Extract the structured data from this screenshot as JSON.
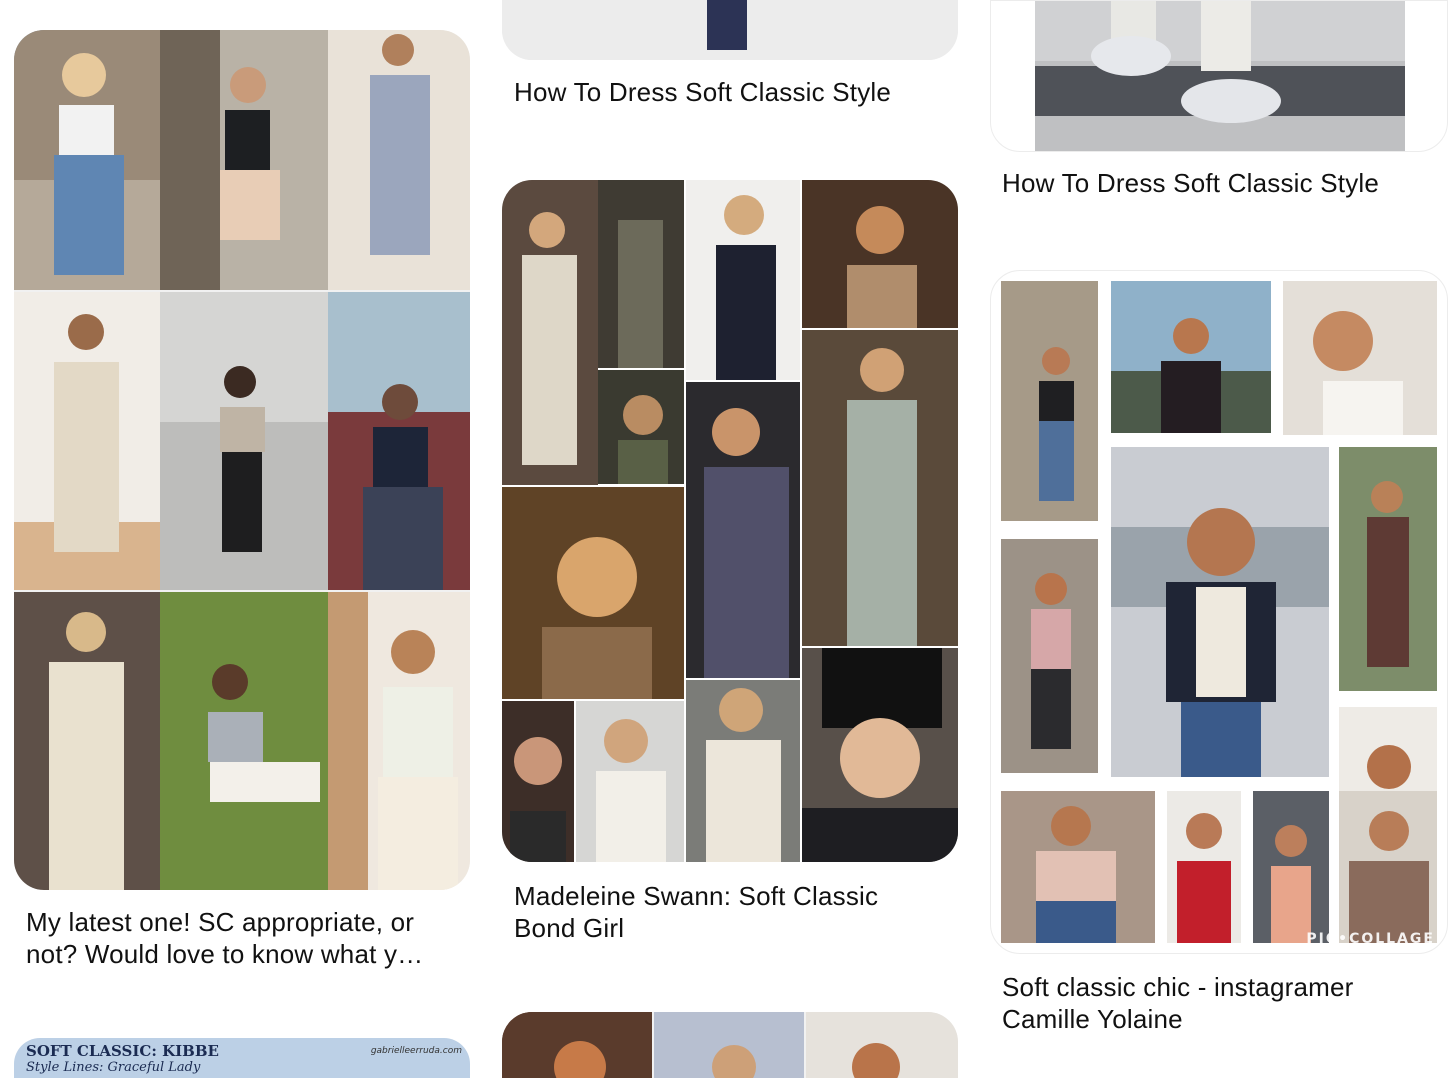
{
  "pins": {
    "col1_top": {
      "title": "My latest one! SC appropriate, or not? Would love to know what y…"
    },
    "col1_bottom": {
      "heading": "SOFT CLASSIC: KIBBE",
      "subheading": "Style Lines: Graceful Lady",
      "site": "gabrielleerruda.com"
    },
    "col2_top": {
      "title": "How To Dress Soft Classic Style"
    },
    "col2_mid": {
      "title": "Madeleine Swann: Soft Classic Bond Girl"
    },
    "col3_top": {
      "title": "How To Dress Soft Classic Style"
    },
    "col3_mid": {
      "title": "Soft classic chic - instagramer Camille Yolaine",
      "watermark": "PIC•COLLAGE"
    }
  }
}
